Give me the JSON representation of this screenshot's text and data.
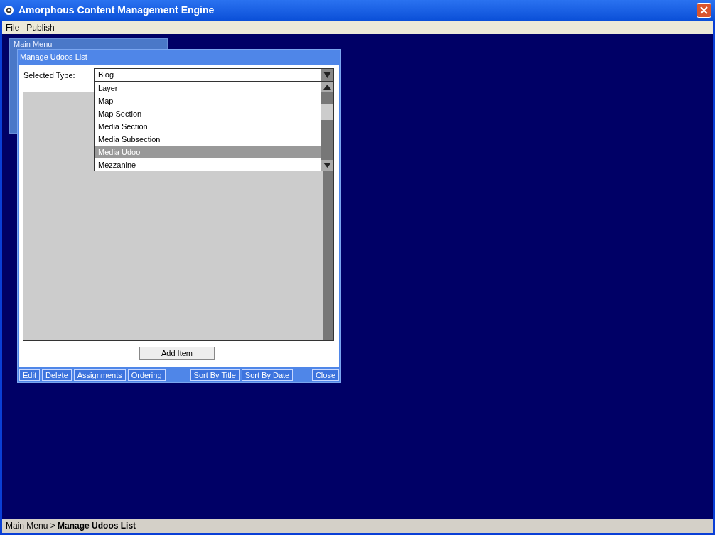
{
  "window": {
    "title": "Amorphous Content Management Engine"
  },
  "menu": [
    "File",
    "Publish"
  ],
  "background_window": {
    "title": "Main Menu"
  },
  "dialog": {
    "title": "Manage Udoos List",
    "selected_type": {
      "label": "Selected Type:",
      "value": "Blog",
      "expanded": true,
      "options": [
        {
          "label": "Layer",
          "selected": false
        },
        {
          "label": "Map",
          "selected": false
        },
        {
          "label": "Map Section",
          "selected": false
        },
        {
          "label": "Media Section",
          "selected": false
        },
        {
          "label": "Media Subsection",
          "selected": false
        },
        {
          "label": "Media Udoo",
          "selected": true
        },
        {
          "label": "Mezzanine",
          "selected": false
        }
      ]
    },
    "add_button": "Add Item",
    "toolbar_left": [
      "Edit",
      "Delete",
      "Assignments",
      "Ordering"
    ],
    "toolbar_middle": [
      "Sort By Title",
      "Sort By Date"
    ],
    "toolbar_right": [
      "Close"
    ]
  },
  "status_bar": {
    "path": "Main Menu",
    "current": "Manage Udoos List",
    "separator": ">"
  }
}
